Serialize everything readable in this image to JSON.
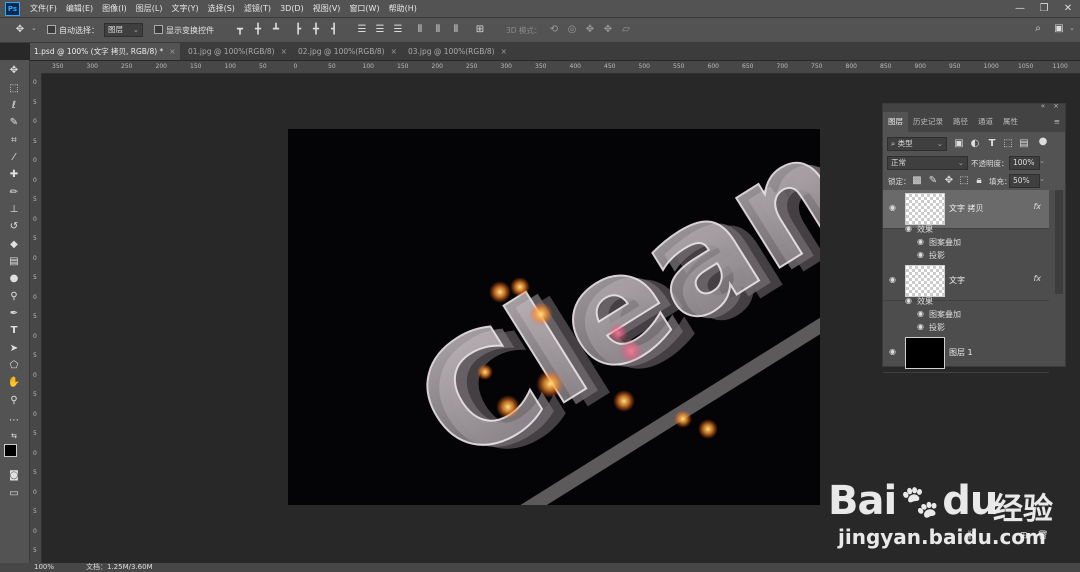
{
  "app": {
    "logo_text": "Ps"
  },
  "menu": [
    "文件(F)",
    "编辑(E)",
    "图像(I)",
    "图层(L)",
    "文字(Y)",
    "选择(S)",
    "滤镜(T)",
    "3D(D)",
    "视图(V)",
    "窗口(W)",
    "帮助(H)"
  ],
  "window_controls": {
    "minimize": "—",
    "restore": "❐",
    "close": "✕"
  },
  "options_bar": {
    "auto_select_label": "自动选择：",
    "auto_select_value": "图层",
    "show_transform_label": "显示变换控件",
    "mode_3d_label": "3D 模式："
  },
  "tabs": [
    {
      "label": "1.psd @ 100% (文字 拷贝, RGB/8) *",
      "close": "×"
    },
    {
      "label": "01.jpg @ 100%(RGB/8)",
      "close": "×"
    },
    {
      "label": "02.jpg @ 100%(RGB/8)",
      "close": "×"
    },
    {
      "label": "03.jpg @ 100%(RGB/8)",
      "close": "×"
    }
  ],
  "ruler_h": [
    "350",
    "300",
    "250",
    "200",
    "150",
    "100",
    "50",
    "0",
    "50",
    "100",
    "150",
    "200",
    "250",
    "300",
    "350",
    "400",
    "450",
    "500",
    "550",
    "600",
    "650",
    "700",
    "750",
    "800",
    "850",
    "900",
    "950",
    "1000",
    "1050",
    "1100"
  ],
  "ruler_v": [
    "0",
    "5",
    "0",
    "5",
    "0",
    "0",
    "5",
    "0",
    "5",
    "0",
    "5",
    "0",
    "5",
    "0",
    "5",
    "0",
    "5",
    "0",
    "5",
    "0",
    "5",
    "0",
    "5",
    "0",
    "5"
  ],
  "canvas": {
    "art_text": "Clean"
  },
  "panel": {
    "tabs": [
      "图层",
      "历史记录",
      "路径",
      "通道",
      "属性"
    ],
    "filter_kind": "类型",
    "blend_mode": "正常",
    "opacity_label": "不透明度：",
    "opacity_value": "100%",
    "lock_label": "锁定：",
    "fill_label": "填充：",
    "fill_value": "50%",
    "layers": [
      {
        "name": "文字 拷贝",
        "fx": "fx",
        "effects_label": "效果",
        "effects": [
          "图案叠加",
          "投影"
        ]
      },
      {
        "name": "文字",
        "fx": "fx",
        "effects_label": "效果",
        "effects": [
          "图案叠加",
          "投影"
        ]
      },
      {
        "name": "图层 1"
      }
    ]
  },
  "status": {
    "zoom": "100%",
    "doc": "文档：1.25M/3.60M"
  },
  "watermark": {
    "brand": "Bai",
    "brand2": "du",
    "jingyan": "经验",
    "url": "jingyan.baidu.com"
  }
}
